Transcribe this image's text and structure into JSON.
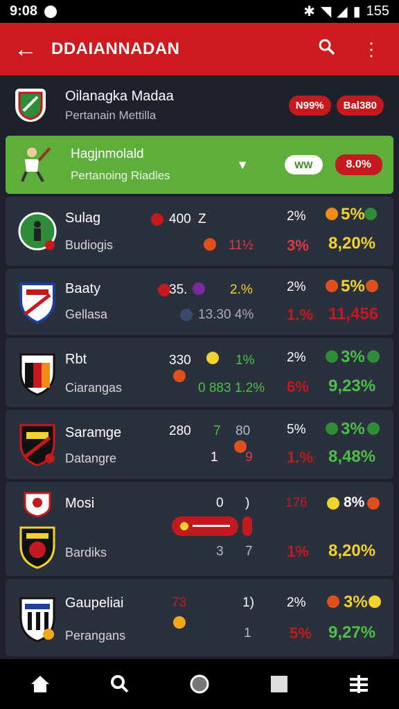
{
  "status": {
    "time": "9:08",
    "battery": "155"
  },
  "app_bar": {
    "title": "DDAIANNADAN"
  },
  "league": {
    "name": "Oilanagka Madaa",
    "subtitle": "Pertanain Mettilla",
    "pill1": "N99%",
    "pill2": "Bal380"
  },
  "highlight": {
    "name": "Hagjnmolald",
    "subtitle": "Pertanoing Riadles",
    "pill_white": "WW",
    "pill_red": "8.0%"
  },
  "rows": [
    {
      "team": "Sulag",
      "sub": "Budiogis",
      "c1": "400",
      "c2": "Z",
      "c3": "11½",
      "pct1": "2%",
      "pct2": "3%",
      "big1": "5%",
      "big2": "8,20%"
    },
    {
      "team": "Baaty",
      "sub": "Gellasa",
      "c1": "35.",
      "c2": "2.%",
      "c3": "13.30 4%",
      "pct1": "2%",
      "pct2": "1.%",
      "big1": "5%",
      "big2": "11,456"
    },
    {
      "team": "Rbt",
      "sub": "Ciarangas",
      "c1": "330",
      "c2": "1%",
      "c3": "0 883 1.2%",
      "pct1": "2%",
      "pct2": "6%",
      "big1": "3%",
      "big2": "9,23%"
    },
    {
      "team": "Saramge",
      "sub": "Datangre",
      "c1": "280",
      "c2": "7",
      "c3": "80",
      "c4": "1",
      "c5": "9",
      "pct1": "5%",
      "pct2": "1.%",
      "big1": "3%",
      "big2": "8,48%"
    },
    {
      "team": "Mosi",
      "sub": "Bardiks",
      "c1": "0",
      "c2": ")",
      "c3": "3",
      "c4": "7",
      "pct1": "176",
      "pct2": "1%",
      "big1": "8%",
      "big2": "8,20%"
    },
    {
      "team": "Gaupeliai",
      "sub": "Perangans",
      "c1": "73",
      "c2": "1)",
      "c3": "1",
      "pct1": "2%",
      "pct2": "5%",
      "big1": "3%",
      "big2": "9,27%"
    }
  ],
  "colors": {
    "accent_red": "#cc1a1f",
    "green": "#5dae3a",
    "yellow": "#f2d22e",
    "row_bg": "#2a303c"
  },
  "nav": [
    "home-icon",
    "search-icon",
    "circle-icon",
    "square-icon",
    "menu-icon"
  ]
}
